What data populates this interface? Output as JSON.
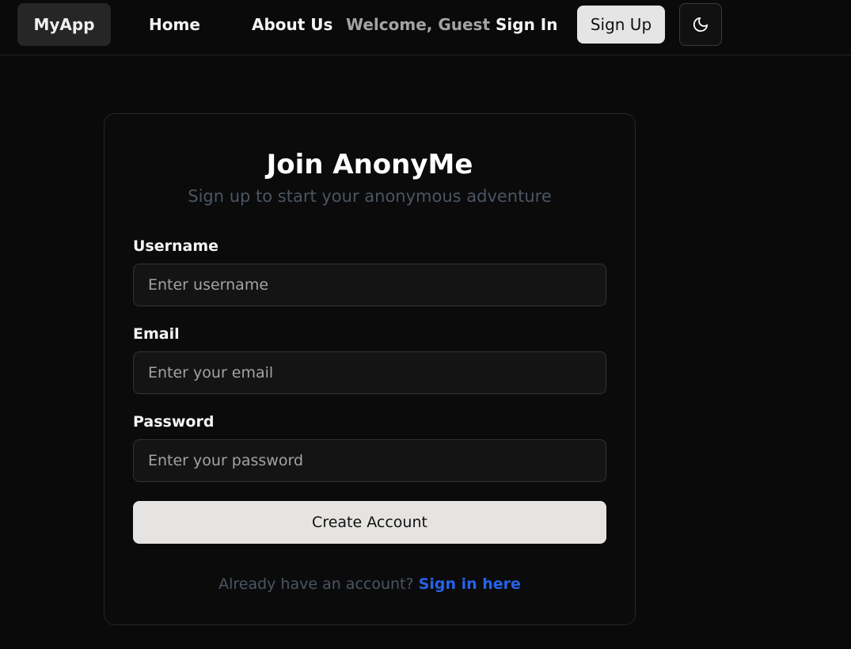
{
  "nav": {
    "logo": "MyApp",
    "home": "Home",
    "about": "About Us",
    "welcome": "Welcome, Guest",
    "sign_in": "Sign In",
    "sign_up": "Sign Up",
    "theme_icon": "moon-icon"
  },
  "form": {
    "title": "Join AnonyMe",
    "subtitle": "Sign up to start your anonymous adventure",
    "username": {
      "label": "Username",
      "placeholder": "Enter username",
      "value": ""
    },
    "email": {
      "label": "Email",
      "placeholder": "Enter your email",
      "value": ""
    },
    "password": {
      "label": "Password",
      "placeholder": "Enter your password",
      "value": ""
    },
    "submit": "Create Account",
    "footer_prompt": "Already have an account?",
    "footer_link": "Sign in here"
  },
  "colors": {
    "background": "#0a0a0a",
    "accent_link": "#2563eb",
    "button_bg": "#e5e4e2"
  }
}
